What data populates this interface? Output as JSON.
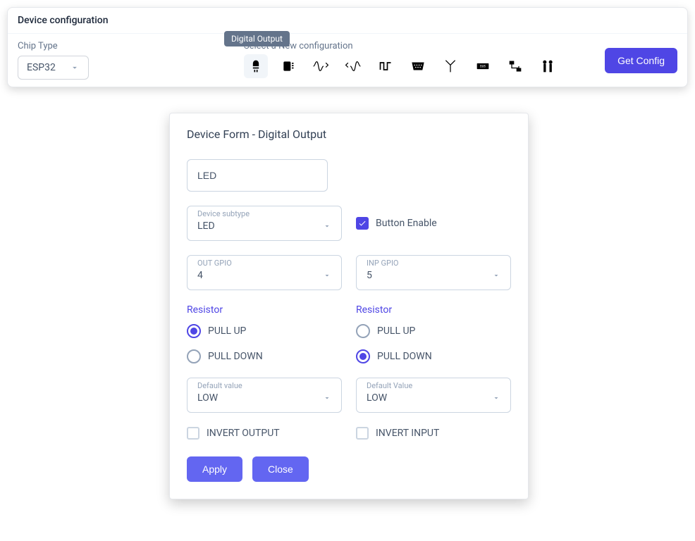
{
  "top": {
    "header": "Device configuration",
    "chip_label": "Chip Type",
    "chip_value": "ESP32",
    "config_label": "Select a New configuration",
    "tooltip": "Digital Output",
    "get_config": "Get Config",
    "icons": [
      "led-icon",
      "chip-icon",
      "wave-icon",
      "signal-icon",
      "pulse-icon",
      "port-icon",
      "antenna-icon",
      "bus-icon",
      "link-icon",
      "pins-icon"
    ]
  },
  "form": {
    "title": "Device Form - Digital Output",
    "name_value": "LED",
    "subtype_label": "Device subtype",
    "subtype_value": "LED",
    "button_enable": "Button Enable",
    "out_gpio_label": "OUT GPIO",
    "out_gpio_value": "4",
    "inp_gpio_label": "INP GPIO",
    "inp_gpio_value": "5",
    "resistor_label": "Resistor",
    "pull_up": "PULL UP",
    "pull_down": "PULL DOWN",
    "default_value_label_left": "Default value",
    "default_value_label_right": "Default Value",
    "default_val": "LOW",
    "invert_output": "INVERT OUTPUT",
    "invert_input": "INVERT INPUT",
    "apply": "Apply",
    "close": "Close"
  }
}
